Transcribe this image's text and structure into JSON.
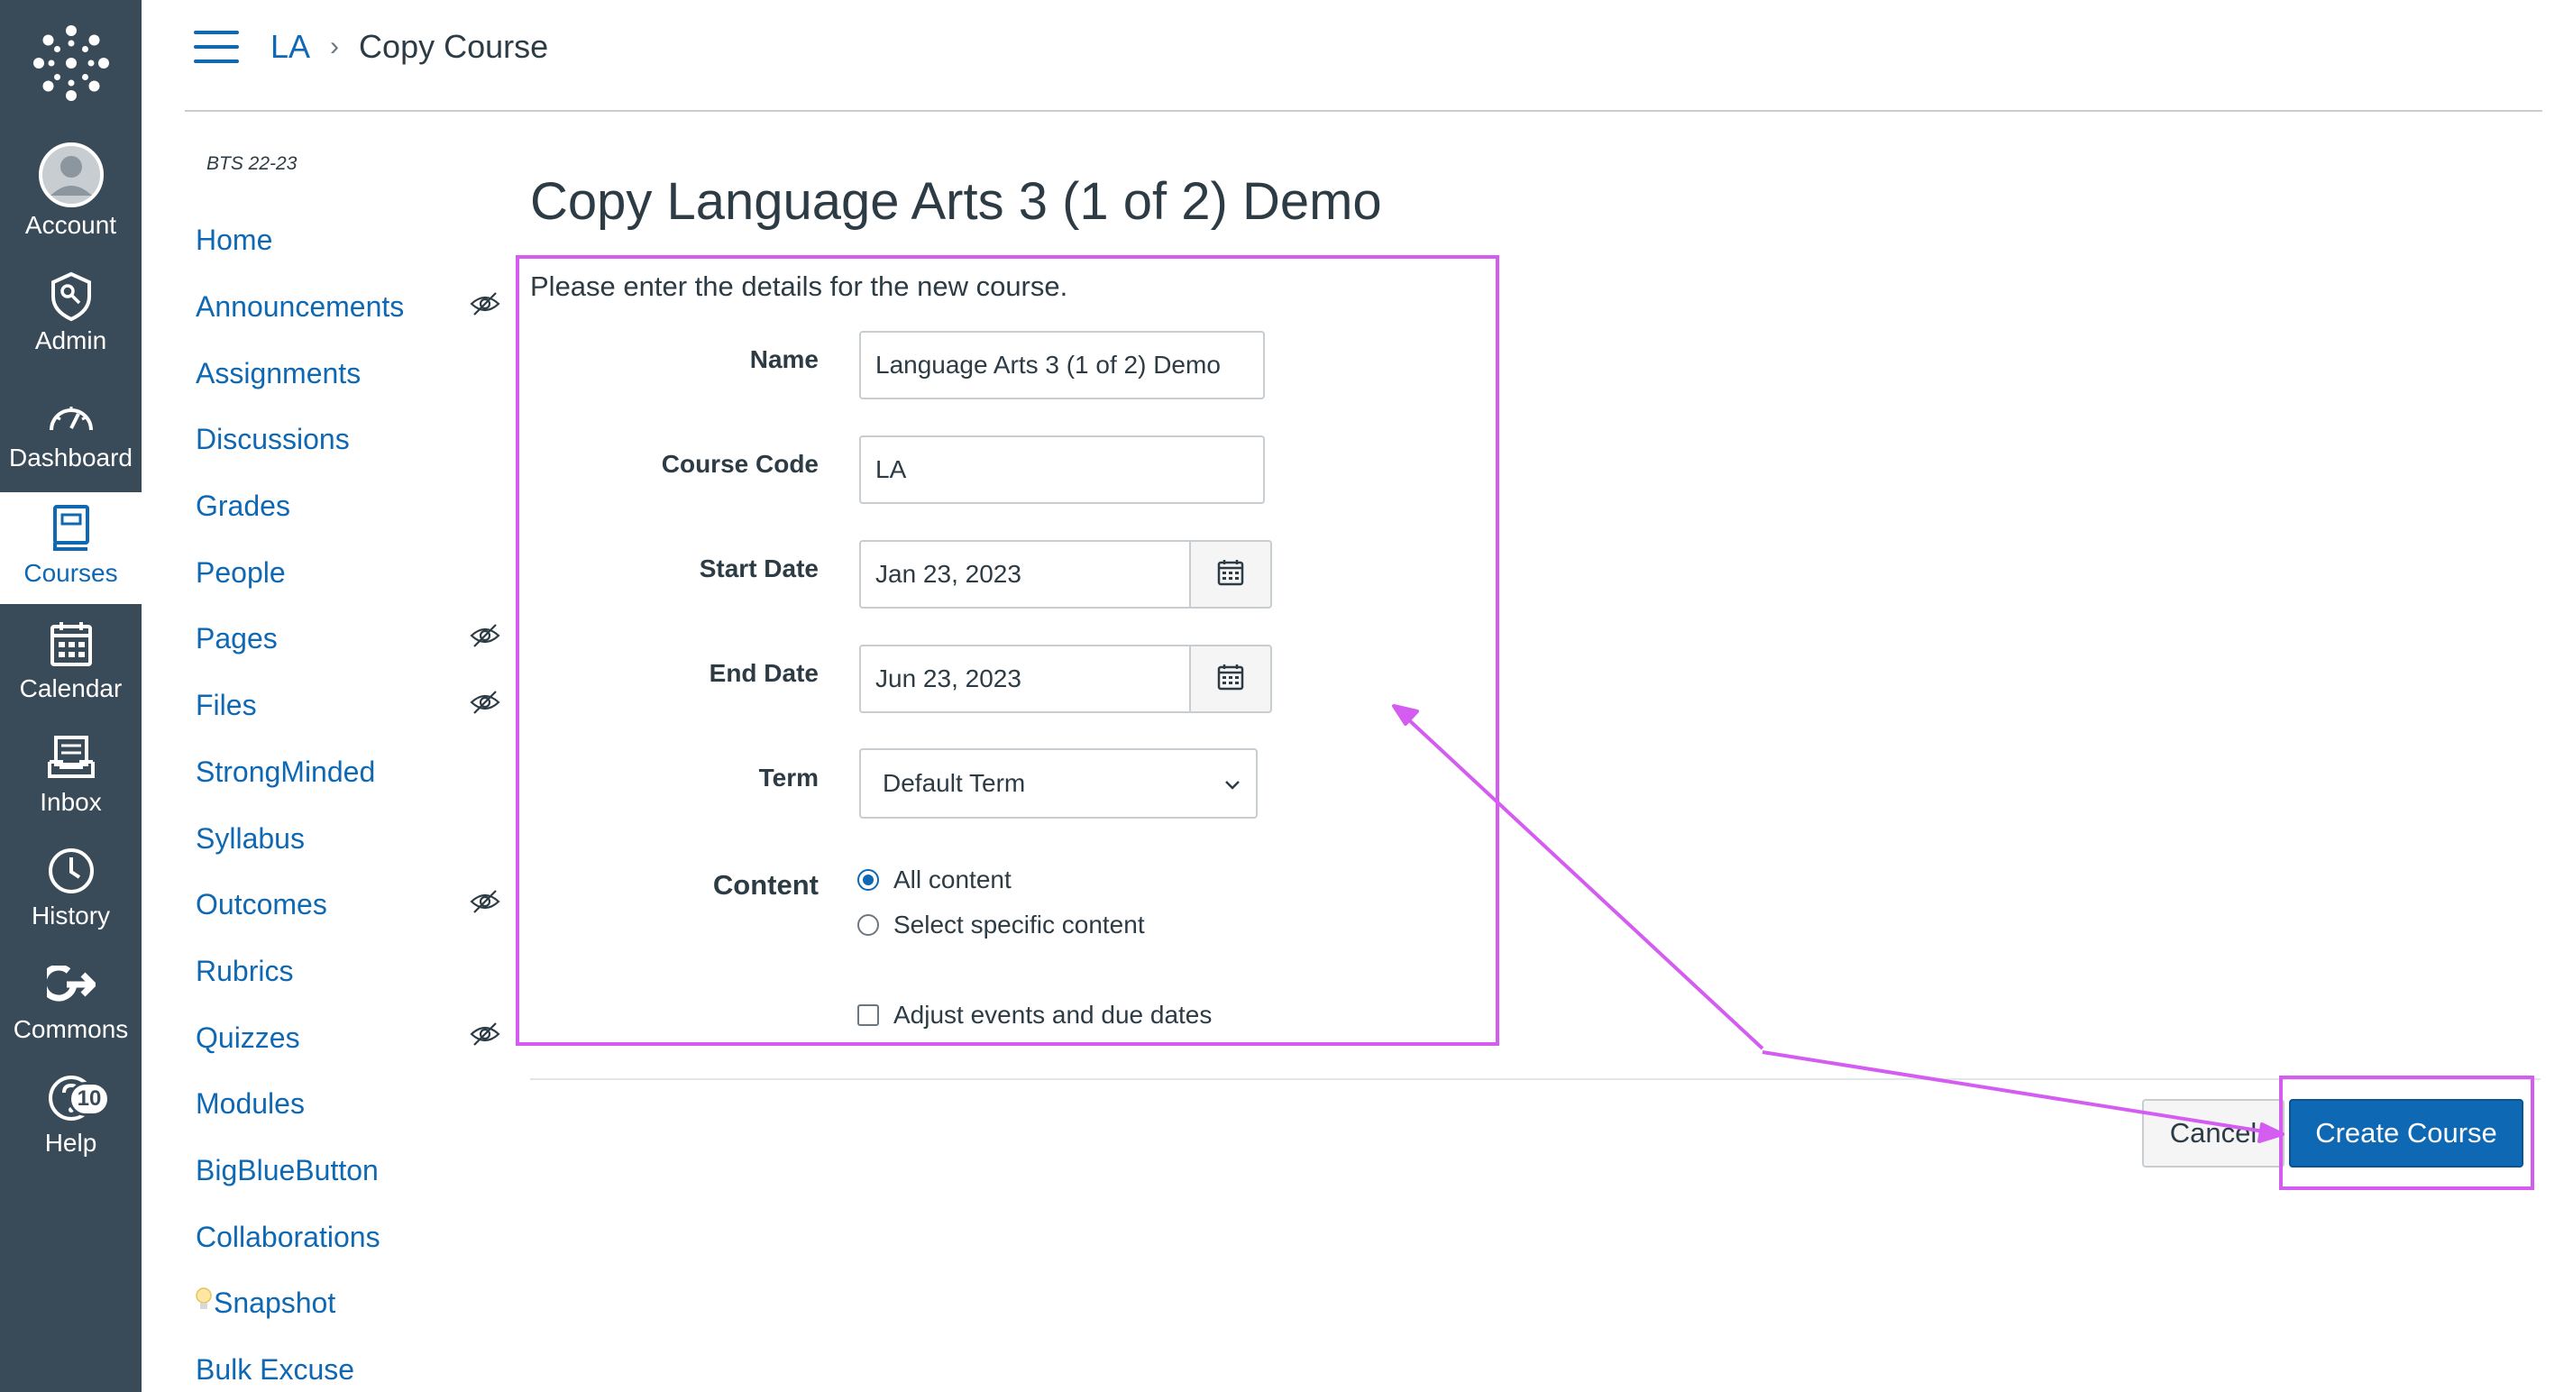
{
  "global_nav": {
    "items": [
      {
        "label": "Account",
        "icon": "account-avatar-icon"
      },
      {
        "label": "Admin",
        "icon": "admin-shield-icon"
      },
      {
        "label": "Dashboard",
        "icon": "dashboard-gauge-icon"
      },
      {
        "label": "Courses",
        "icon": "courses-book-icon",
        "active": true
      },
      {
        "label": "Calendar",
        "icon": "calendar-icon"
      },
      {
        "label": "Inbox",
        "icon": "inbox-icon"
      },
      {
        "label": "History",
        "icon": "history-clock-icon"
      },
      {
        "label": "Commons",
        "icon": "commons-arrow-icon"
      },
      {
        "label": "Help",
        "icon": "help-question-icon",
        "badge": "10"
      }
    ]
  },
  "header": {
    "breadcrumb": [
      {
        "label": "LA"
      },
      {
        "label": "Copy Course"
      }
    ]
  },
  "course_nav": {
    "term": "BTS 22-23",
    "items": [
      {
        "label": "Home",
        "hidden": false
      },
      {
        "label": "Announcements",
        "hidden": true
      },
      {
        "label": "Assignments",
        "hidden": false
      },
      {
        "label": "Discussions",
        "hidden": false
      },
      {
        "label": "Grades",
        "hidden": false
      },
      {
        "label": "People",
        "hidden": false
      },
      {
        "label": "Pages",
        "hidden": true
      },
      {
        "label": "Files",
        "hidden": true
      },
      {
        "label": "StrongMinded",
        "hidden": false
      },
      {
        "label": "Syllabus",
        "hidden": false
      },
      {
        "label": "Outcomes",
        "hidden": true
      },
      {
        "label": "Rubrics",
        "hidden": false
      },
      {
        "label": "Quizzes",
        "hidden": true
      },
      {
        "label": "Modules",
        "hidden": false
      },
      {
        "label": "BigBlueButton",
        "hidden": false
      },
      {
        "label": "Collaborations",
        "hidden": false
      },
      {
        "label": "Snapshot",
        "hidden": false,
        "icon": "lightbulb-icon"
      },
      {
        "label": "Bulk Excuse",
        "hidden": false
      }
    ]
  },
  "main": {
    "title": "Copy Language Arts 3 (1 of 2) Demo",
    "intro": "Please enter the details for the new course.",
    "form": {
      "name_label": "Name",
      "name_value": "Language Arts 3 (1 of 2) Demo",
      "code_label": "Course Code",
      "code_value": "LA",
      "start_label": "Start Date",
      "start_value": "Jan 23, 2023",
      "end_label": "End Date",
      "end_value": "Jun 23, 2023",
      "term_label": "Term",
      "term_value": "Default Term",
      "content_label": "Content",
      "content_options": [
        {
          "label": "All content",
          "checked": true
        },
        {
          "label": "Select specific content",
          "checked": false
        }
      ],
      "adjust_label": "Adjust events and due dates",
      "adjust_checked": false
    },
    "buttons": {
      "cancel": "Cancel",
      "create": "Create Course"
    }
  },
  "annotation": {
    "highlight_color": "#d45cf0"
  }
}
